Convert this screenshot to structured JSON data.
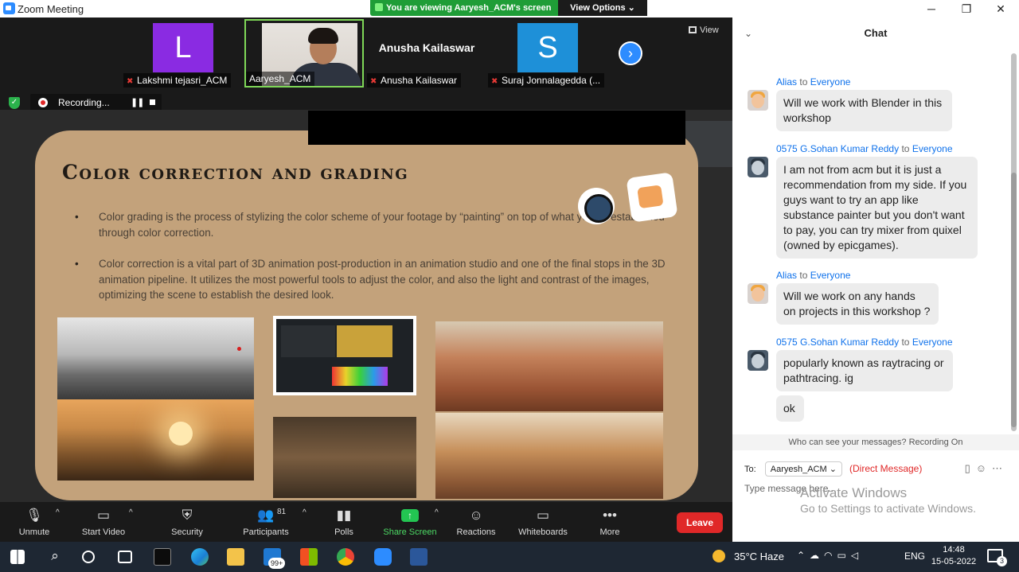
{
  "window": {
    "title": "Zoom Meeting",
    "minimize": "─",
    "maximize": "❐",
    "close": "✕"
  },
  "banner": {
    "viewing_text": "You are viewing Aaryesh_ACM's screen",
    "view_options": "View Options ⌄"
  },
  "participants": [
    {
      "name": "Lakshmi tejasri_ACM",
      "initial": "L",
      "color": "#8a2be2"
    },
    {
      "name": "Aaryesh_ACM"
    },
    {
      "name": "Anusha Kailaswar",
      "big_name": "Anusha Kailaswar"
    },
    {
      "name": "Suraj Jonnalagedda (...",
      "initial": "S",
      "color": "#1e90d8"
    }
  ],
  "view_button": "View",
  "recording": {
    "label": "Recording...",
    "pause": "❚❚"
  },
  "slide": {
    "title": "Color correction and grading",
    "bullet1": "Color grading is the process of stylizing the color scheme of your footage by “painting” on top of what you’ve established through color correction.",
    "bullet2": "Color correction is a vital part of 3D animation post-production in an animation studio and one of the final stops in the 3D animation pipeline. It utilizes the most powerful tools to adjust the color, and also the light and contrast of the images, optimizing the scene to establish the desired look."
  },
  "toolbar": {
    "unmute": "Unmute",
    "start_video": "Start Video",
    "security": "Security",
    "participants": "Participants",
    "participant_count": "81",
    "polls": "Polls",
    "share_screen": "Share Screen",
    "reactions": "Reactions",
    "whiteboards": "Whiteboards",
    "more": "More",
    "leave": "Leave"
  },
  "chat": {
    "header": "Chat",
    "messages": [
      {
        "from": "Alias",
        "to_word": "to",
        "to": "Everyone",
        "text": "Will we work with Blender in this workshop"
      },
      {
        "from": "0575 G.Sohan Kumar Reddy",
        "to_word": "to",
        "to": "Everyone",
        "text": "I am not from acm but it is just a recommendation from my side. If you guys want to try an app like substance painter but you don't want to pay, you can try mixer from quixel (owned by epicgames)."
      },
      {
        "from": "Alias",
        "to_word": "to",
        "to": "Everyone",
        "text": "Will we work on any hands on projects in this workshop ?"
      },
      {
        "from": "0575 G.Sohan Kumar Reddy",
        "to_word": "to",
        "to": "Everyone",
        "text": "popularly known as raytracing or pathtracing. ig"
      },
      {
        "text": "ok"
      }
    ],
    "who_can_see": "Who can see your messages? Recording On",
    "to_label": "To:",
    "recipient": "Aaryesh_ACM ⌄",
    "direct_message": "(Direct Message)",
    "input_placeholder": "Type message here..."
  },
  "activate": {
    "line1": "Activate Windows",
    "line2": "Go to Settings to activate Windows."
  },
  "taskbar": {
    "weather": "35°C  Haze",
    "language": "ENG",
    "time": "14:48",
    "date": "15-05-2022",
    "mail_badge": "99+",
    "notification_count": "3"
  }
}
